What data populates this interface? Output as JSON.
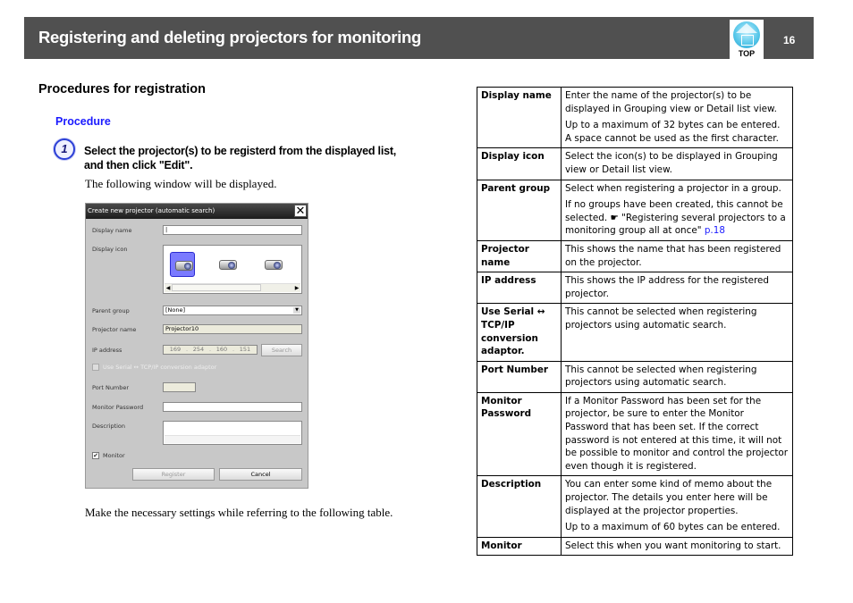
{
  "header": {
    "title": "Registering and deleting projectors for monitoring",
    "top_icon_label": "TOP",
    "page_number": "16"
  },
  "section_title": "Procedures for registration",
  "procedure_label": "Procedure",
  "step": {
    "number": "1",
    "text": "Select the projector(s) to be registerd from the displayed list, and then click \"Edit\".",
    "sub": "The following window will be displayed."
  },
  "dialog": {
    "title": "Create new projector (automatic search)",
    "close_glyph": "✕",
    "labels": {
      "display_name": "Display name",
      "display_icon": "Display icon",
      "parent_group": "Parent group",
      "projector_name": "Projector name",
      "ip_address": "IP address",
      "use_serial": "Use Serial ↔ TCP/IP conversion adaptor",
      "port_number": "Port Number",
      "monitor_password": "Monitor Password",
      "description": "Description",
      "monitor": "Monitor"
    },
    "values": {
      "display_name": "|",
      "parent_group": "[None]",
      "projector_name": "Projector10",
      "ip": [
        "169",
        "254",
        "160",
        "151"
      ],
      "port_number": "",
      "monitor_password": "",
      "description": "",
      "monitor_checked": "✔"
    },
    "buttons": {
      "search": "Search",
      "register": "Register",
      "cancel": "Cancel"
    },
    "icons": [
      "projector-icon-1",
      "projector-icon-2",
      "projector-icon-3"
    ]
  },
  "bottom_note": "Make the necessary settings while referring to the following table.",
  "table": {
    "rows": [
      {
        "key": "Display name",
        "values": [
          "Enter the name of the projector(s) to be displayed in Grouping view or Detail list view.",
          "Up to a maximum of 32 bytes can be entered. A space cannot be used as the first character."
        ]
      },
      {
        "key": "Display icon",
        "values": [
          "Select the icon(s) to be displayed in Grouping view or Detail list view."
        ]
      },
      {
        "key": "Parent group",
        "values": [
          "Select when registering a projector in a group."
        ],
        "extra": {
          "pre": "If no groups have been created, this cannot be selected. ",
          "pointer": "☛",
          "ref": " \"Registering several projectors to a monitoring group all at once\" ",
          "link": "p.18"
        }
      },
      {
        "key": "Projector name",
        "values": [
          "This shows the name that has been registered on the projector."
        ]
      },
      {
        "key": "IP address",
        "values": [
          "This shows the IP address for the registered projector."
        ]
      },
      {
        "key": "Use Serial ↔ TCP/IP conversion adaptor.",
        "values": [
          "This cannot be selected when registering projectors using automatic search."
        ]
      },
      {
        "key": "Port Number",
        "values": [
          "This cannot be selected when registering projectors using automatic search."
        ]
      },
      {
        "key": "Monitor Password",
        "values": [
          "If a Monitor Password has been set for the projector, be sure to enter the Monitor Password that has been set. If the correct password is not entered at this time, it will not be possible to monitor and control the projector even though it is registered."
        ]
      },
      {
        "key": "Description",
        "values": [
          "You can enter some kind of memo about the projector. The details you enter here will be displayed at the projector properties.",
          "Up to a maximum of 60 bytes can be entered."
        ]
      },
      {
        "key": "Monitor",
        "values": [
          "Select this when you want monitoring to start."
        ]
      }
    ]
  }
}
